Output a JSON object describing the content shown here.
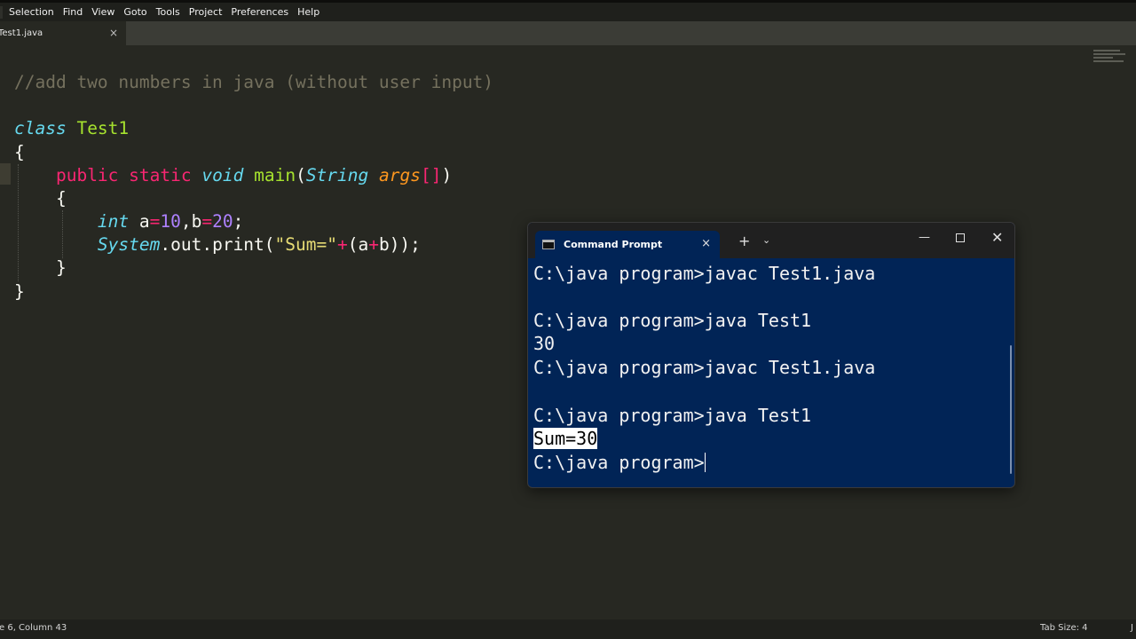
{
  "menu": {
    "items": [
      "Selection",
      "Find",
      "View",
      "Goto",
      "Tools",
      "Project",
      "Preferences",
      "Help"
    ]
  },
  "tab": {
    "label": "Test1.java",
    "close": "×"
  },
  "code": {
    "comment": "//add two numbers in java (without user input)",
    "class_kw": "class",
    "class_name": "Test1",
    "open_brace": "{",
    "close_brace": "}",
    "public_kw": "public",
    "static_kw": "static",
    "void_kw": "void",
    "main_name": "main",
    "lparen": "(",
    "rparen": ")",
    "string_type": "String",
    "args_name": "args",
    "brackets": "[]",
    "int_kw": "int",
    "var_a": " a",
    "eq": "=",
    "ten": "10",
    "comma_b": ",b",
    "twenty": "20",
    "semi": ";",
    "system_name": "System",
    "out_print": ".out.print(",
    "sum_str": "\"Sum=\"",
    "plus": "+",
    "paren_a": "(a",
    "b_close": "b));"
  },
  "cmd": {
    "title": "Command Prompt",
    "tab_close": "×",
    "new_tab": "+",
    "dropdown": "⌄",
    "minimize": "—",
    "close": "✕",
    "lines": [
      "C:\\java program>javac Test1.java",
      "",
      "C:\\java program>java Test1",
      "30",
      "C:\\java program>javac Test1.java",
      "",
      "C:\\java program>java Test1",
      "Sum=30",
      "C:\\java program>"
    ]
  },
  "status": {
    "position": "e 6, Column 43",
    "tab_size": "Tab Size: 4",
    "extra": "J"
  }
}
